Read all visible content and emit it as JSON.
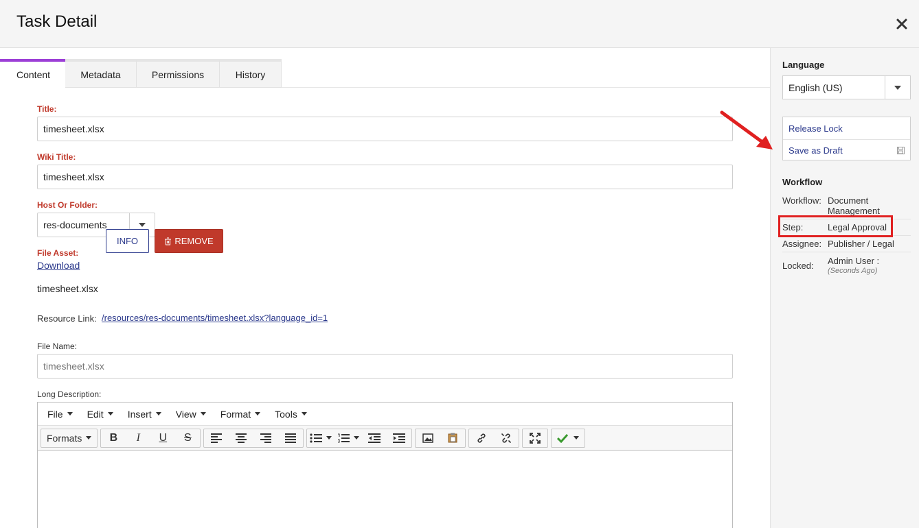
{
  "dialog": {
    "title": "Task Detail"
  },
  "tabs": [
    {
      "label": "Content"
    },
    {
      "label": "Metadata"
    },
    {
      "label": "Permissions"
    },
    {
      "label": "History"
    }
  ],
  "form": {
    "title": {
      "label": "Title:",
      "value": "timesheet.xlsx"
    },
    "wiki_title": {
      "label": "Wiki Title:",
      "value": "timesheet.xlsx"
    },
    "host": {
      "label": "Host Or Folder:",
      "value": "res-documents"
    },
    "file_asset": {
      "label": "File Asset:",
      "download_label": "Download",
      "filename": "timesheet.xlsx",
      "info_button": "INFO",
      "remove_button": "REMOVE"
    },
    "resource_link": {
      "label": "Resource Link:",
      "value": "/resources/res-documents/timesheet.xlsx?language_id=1"
    },
    "file_name": {
      "label": "File Name:",
      "placeholder": "timesheet.xlsx"
    },
    "long_description": {
      "label": "Long Description:"
    }
  },
  "editor": {
    "menus": [
      "File",
      "Edit",
      "Insert",
      "View",
      "Format",
      "Tools"
    ],
    "formats_label": "Formats",
    "bold": "B",
    "italic": "I",
    "underline": "U",
    "strike": "S"
  },
  "sidebar": {
    "language": {
      "heading": "Language",
      "value": "English (US)"
    },
    "actions": {
      "release_lock": "Release Lock",
      "save_draft": "Save as Draft"
    },
    "workflow": {
      "heading": "Workflow",
      "workflow_key": "Workflow:",
      "workflow_val": "Document Management",
      "step_key": "Step:",
      "step_val": "Legal Approval",
      "assignee_key": "Assignee:",
      "assignee_val": "Publisher / Legal",
      "locked_key": "Locked:",
      "locked_val": "Admin User :",
      "locked_time": "(Seconds Ago)"
    }
  },
  "colors": {
    "accent_tab": "#9c3fd6",
    "required_label": "#c0392b",
    "link": "#2c3a8c",
    "remove_button": "#c0392b",
    "annotation": "#e02020"
  },
  "icons": [
    "close-icon",
    "caret-down-icon",
    "trash-icon",
    "save-icon",
    "image-icon",
    "paste-icon",
    "link-icon",
    "unlink-icon",
    "fullscreen-icon",
    "spellcheck-icon"
  ]
}
